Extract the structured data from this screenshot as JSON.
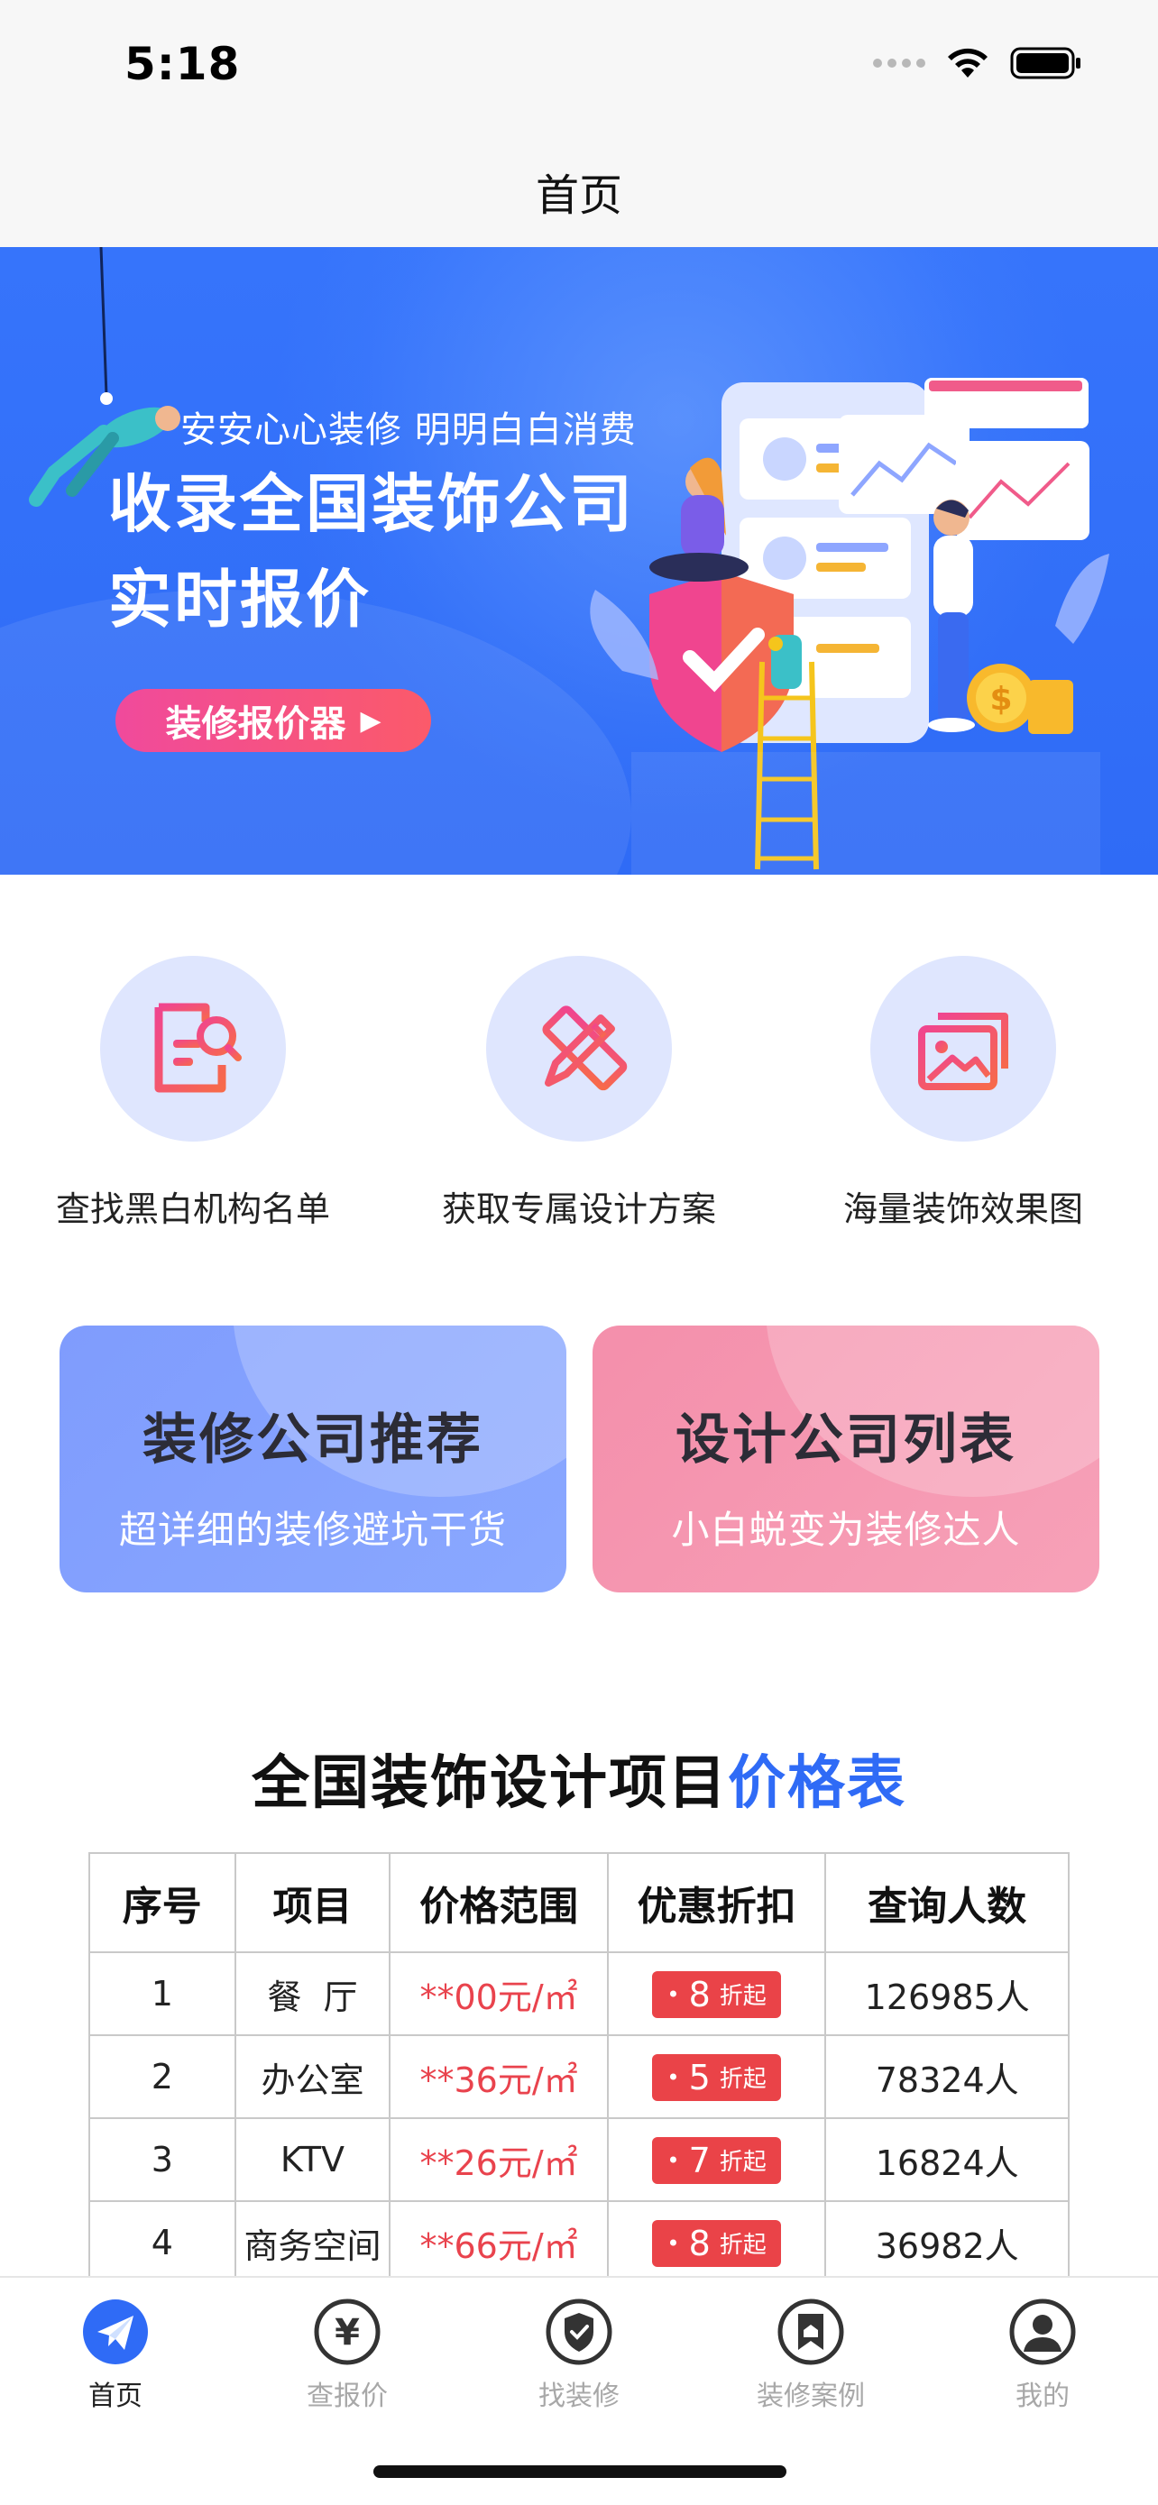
{
  "status_bar": {
    "time": "5:18"
  },
  "nav": {
    "title": "首页"
  },
  "banner": {
    "slogan": "安安心心装修  明明白白消费",
    "title_line1": "收录全国装饰公司",
    "title_line2": "实时报价",
    "button_label": "装修报价器",
    "button_arrow": "▶"
  },
  "features": [
    {
      "label": "查找黑白机构名单",
      "icon": "document-search-icon"
    },
    {
      "label": "获取专属设计方案",
      "icon": "ruler-pencil-icon"
    },
    {
      "label": "海量装饰效果图",
      "icon": "gallery-icon"
    }
  ],
  "cards": [
    {
      "title": "装修公司推荐",
      "subtitle": "超详细的装修避坑干货"
    },
    {
      "title": "设计公司列表",
      "subtitle": "小白蜕变为装修达人"
    }
  ],
  "price_section": {
    "title": "全国装饰设计项目",
    "title_accent": "价格表",
    "headers": [
      "序号",
      "项目",
      "价格范围",
      "优惠折扣",
      "查询人数"
    ],
    "discount_suffix": "折起",
    "discount_dot": "•",
    "rows": [
      {
        "no": "1",
        "item": "餐  厅",
        "price": "**00元/㎡",
        "discount": "8",
        "count": "126985人"
      },
      {
        "no": "2",
        "item": "办公室",
        "price": "**36元/㎡",
        "discount": "5",
        "count": "78324人"
      },
      {
        "no": "3",
        "item": "KTV",
        "price": "**26元/㎡",
        "discount": "7",
        "count": "16824人"
      },
      {
        "no": "4",
        "item": "商务空间",
        "price": "**66元/㎡",
        "discount": "8",
        "count": "36982人"
      }
    ]
  },
  "tab_bar": {
    "active_color": "#2f6bf6",
    "items": [
      {
        "label": "首页",
        "icon": "paper-plane-icon",
        "active": true
      },
      {
        "label": "查报价",
        "icon": "yen-icon",
        "active": false
      },
      {
        "label": "找装修",
        "icon": "shield-check-icon",
        "active": false
      },
      {
        "label": "装修案例",
        "icon": "bookmark-icon",
        "active": false
      },
      {
        "label": "我的",
        "icon": "user-icon",
        "active": false
      }
    ]
  },
  "colors": {
    "brand_blue": "#2f6bf6",
    "price_red": "#e9434d",
    "card_blue": "#8aa8ff",
    "card_pink": "#f7a1b8"
  }
}
